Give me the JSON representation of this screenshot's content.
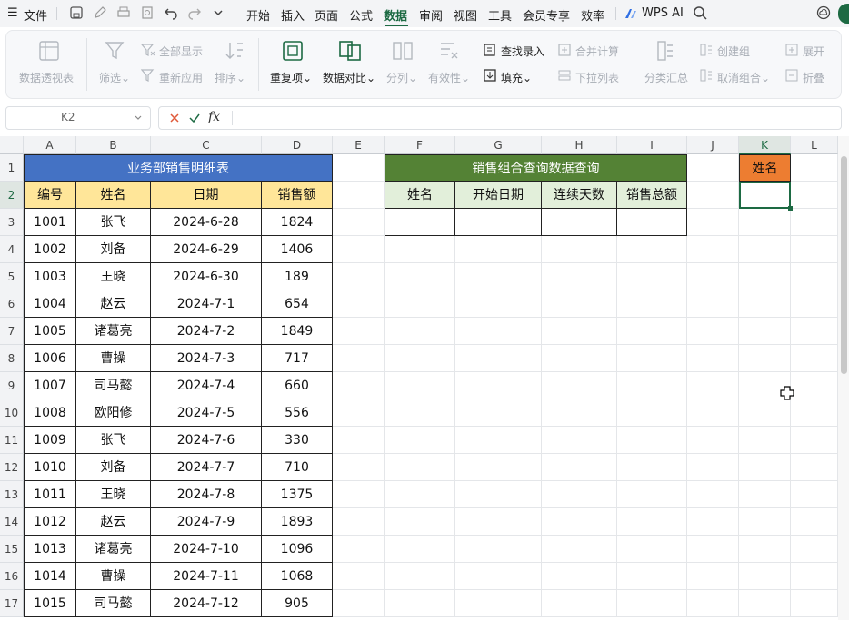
{
  "menubar": {
    "file": "文件",
    "tabs": [
      "开始",
      "插入",
      "页面",
      "公式",
      "数据",
      "审阅",
      "视图",
      "工具",
      "会员专享",
      "效率"
    ],
    "active_tab": "数据",
    "wps_ai": "WPS AI"
  },
  "ribbon": {
    "pivot": "数据透视表",
    "filter": "筛选",
    "show_all": "全部显示",
    "reapply": "重新应用",
    "sort": "排序",
    "duplicates": "重复项",
    "compare": "数据对比",
    "split": "分列",
    "validity": "有效性",
    "find_entry": "查找录入",
    "fill": "填充",
    "consolidate": "合并计算",
    "dropdown": "下拉列表",
    "subtotal": "分类汇总",
    "group": "创建组",
    "ungroup": "取消组合",
    "expand": "展开",
    "collapse": "折叠"
  },
  "formula_bar": {
    "cell_ref": "K2",
    "fx": "fx",
    "content": ""
  },
  "sheet": {
    "columns": [
      "A",
      "B",
      "C",
      "D",
      "E",
      "F",
      "G",
      "H",
      "I",
      "J",
      "K",
      "L"
    ],
    "rows": [
      "1",
      "2",
      "3",
      "4",
      "5",
      "6",
      "7",
      "8",
      "9",
      "10",
      "11",
      "12",
      "13",
      "14",
      "15",
      "16",
      "17"
    ],
    "table1_title": "业务部销售明细表",
    "table1_headers": [
      "编号",
      "姓名",
      "日期",
      "销售额"
    ],
    "table1_rows": [
      [
        "1001",
        "张飞",
        "2024-6-28",
        "1824"
      ],
      [
        "1002",
        "刘备",
        "2024-6-29",
        "1406"
      ],
      [
        "1003",
        "王晓",
        "2024-6-30",
        "189"
      ],
      [
        "1004",
        "赵云",
        "2024-7-1",
        "654"
      ],
      [
        "1005",
        "诸葛亮",
        "2024-7-2",
        "1849"
      ],
      [
        "1006",
        "曹操",
        "2024-7-3",
        "717"
      ],
      [
        "1007",
        "司马懿",
        "2024-7-4",
        "660"
      ],
      [
        "1008",
        "欧阳修",
        "2024-7-5",
        "556"
      ],
      [
        "1009",
        "张飞",
        "2024-7-6",
        "330"
      ],
      [
        "1010",
        "刘备",
        "2024-7-7",
        "710"
      ],
      [
        "1011",
        "王晓",
        "2024-7-8",
        "1375"
      ],
      [
        "1012",
        "赵云",
        "2024-7-9",
        "1893"
      ],
      [
        "1013",
        "诸葛亮",
        "2024-7-10",
        "1096"
      ],
      [
        "1014",
        "曹操",
        "2024-7-11",
        "1068"
      ],
      [
        "1015",
        "司马懿",
        "2024-7-12",
        "905"
      ]
    ],
    "table2_title": "销售组合查询数据查询",
    "table2_headers": [
      "姓名",
      "开始日期",
      "连续天数",
      "销售总额"
    ],
    "k1_label": "姓名",
    "colors": {
      "title_blue": "#4472c4",
      "header_yellow": "#ffe699",
      "title_green": "#548235",
      "header_lightgreen": "#e2efda",
      "orange": "#ed7d31",
      "active_green": "#1d6a43"
    }
  }
}
